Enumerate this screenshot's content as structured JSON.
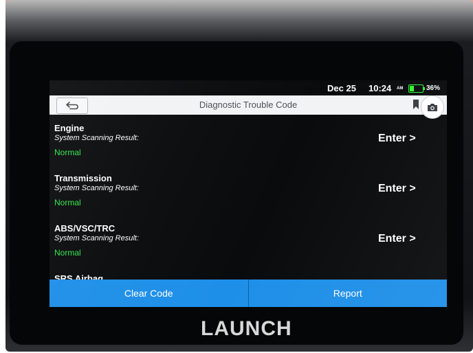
{
  "status_bar": {
    "date": "Dec 25",
    "time": "10:24",
    "ampm": "AM",
    "battery_percent": 36,
    "battery_label": "36%"
  },
  "header": {
    "back_icon": "back-arrow-icon",
    "title": "Diagnostic Trouble Code",
    "bookmark_icon": "bookmark-icon",
    "camera_icon": "camera-icon"
  },
  "systems": [
    {
      "name": "Engine",
      "subtitle": "System Scanning Result:",
      "status": "Normal",
      "action": "Enter >"
    },
    {
      "name": "Transmission",
      "subtitle": "System Scanning Result:",
      "status": "Normal",
      "action": "Enter >"
    },
    {
      "name": "ABS/VSC/TRC",
      "subtitle": "System Scanning Result:",
      "status": "Normal",
      "action": "Enter >"
    },
    {
      "name": "SRS Airbag"
    }
  ],
  "bottom_bar": {
    "clear_code": "Clear Code",
    "report": "Report"
  },
  "device": {
    "brand": "LAUNCH"
  },
  "colors": {
    "accent": "#1e8fe8",
    "status_normal": "#2ee84a",
    "battery": "#2eff2e"
  }
}
